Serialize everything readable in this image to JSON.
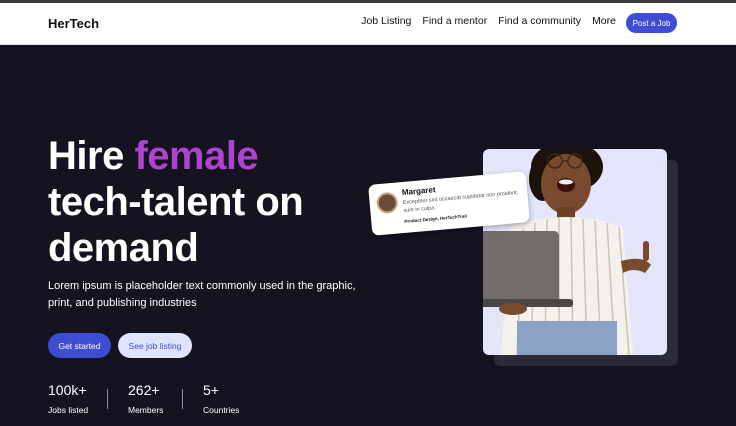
{
  "brand": "HerTech",
  "nav": {
    "links": [
      "Job Listing",
      "Find a mentor",
      "Find a community",
      "More"
    ],
    "cta": "Post a Job"
  },
  "hero": {
    "headline_accent_prefix": "Hire ",
    "headline_accent": "female",
    "headline_line2": "tech-talent on",
    "headline_line3": "demand",
    "subtext": "Lorem ipsum is placeholder text commonly used in the graphic, print, and publishing industries",
    "primary_button": "Get started",
    "secondary_button": "See job listing"
  },
  "stats": [
    {
      "value": "100k+",
      "label": "Jobs listed"
    },
    {
      "value": "262+",
      "label": "Members"
    },
    {
      "value": "5+",
      "label": "Countries"
    }
  ],
  "testimonial": {
    "name": "Margaret",
    "text": "Excepteur sint occaecat cupidatat non proident, sunt in culpa.",
    "role": "Product Design, HerTechTrail"
  },
  "colors": {
    "accent": "#b042d2",
    "primary": "#3d4ed3",
    "hero_bg": "#15131f"
  }
}
